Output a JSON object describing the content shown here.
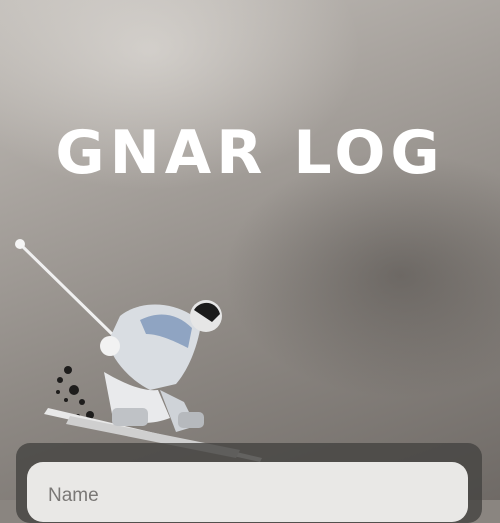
{
  "app": {
    "title": "GNAR LOG"
  },
  "form": {
    "name_placeholder": "Name"
  }
}
